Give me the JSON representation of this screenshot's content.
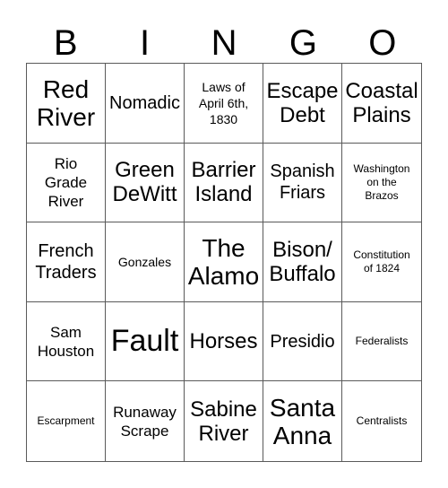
{
  "card": {
    "title": "BINGO",
    "header_letters": [
      "B",
      "I",
      "N",
      "G",
      "O"
    ],
    "rows": 5,
    "columns": 5,
    "border_color": "#5a5a5a",
    "text_color": "#000000",
    "background_color": "#ffffff",
    "cells": [
      {
        "text": "Red\nRiver",
        "size": "sz-xl"
      },
      {
        "text": "Nomadic",
        "size": "sz-md"
      },
      {
        "text": "Laws of\nApril 6th,\n1830",
        "size": "sz-xs"
      },
      {
        "text": "Escape\nDebt",
        "size": "sz-lg"
      },
      {
        "text": "Coastal\nPlains",
        "size": "sz-lg"
      },
      {
        "text": "Rio\nGrade\nRiver",
        "size": "sz-sm"
      },
      {
        "text": "Green\nDeWitt",
        "size": "sz-lg"
      },
      {
        "text": "Barrier\nIsland",
        "size": "sz-lg"
      },
      {
        "text": "Spanish\nFriars",
        "size": "sz-md"
      },
      {
        "text": "Washington\non the\nBrazos",
        "size": "sz-xxs"
      },
      {
        "text": "French\nTraders",
        "size": "sz-md"
      },
      {
        "text": "Gonzales",
        "size": "sz-xs"
      },
      {
        "text": "The\nAlamo",
        "size": "sz-xl"
      },
      {
        "text": "Bison/\nBuffalo",
        "size": "sz-lg"
      },
      {
        "text": "Constitution\nof 1824",
        "size": "sz-xxs"
      },
      {
        "text": "Sam\nHouston",
        "size": "sz-sm"
      },
      {
        "text": "Fault",
        "size": "sz-xxl"
      },
      {
        "text": "Horses",
        "size": "sz-lg"
      },
      {
        "text": "Presidio",
        "size": "sz-md"
      },
      {
        "text": "Federalists",
        "size": "sz-xxs"
      },
      {
        "text": "Escarpment",
        "size": "sz-xxs"
      },
      {
        "text": "Runaway\nScrape",
        "size": "sz-sm"
      },
      {
        "text": "Sabine\nRiver",
        "size": "sz-lg"
      },
      {
        "text": "Santa\nAnna",
        "size": "sz-xl"
      },
      {
        "text": "Centralists",
        "size": "sz-xxs"
      }
    ]
  }
}
